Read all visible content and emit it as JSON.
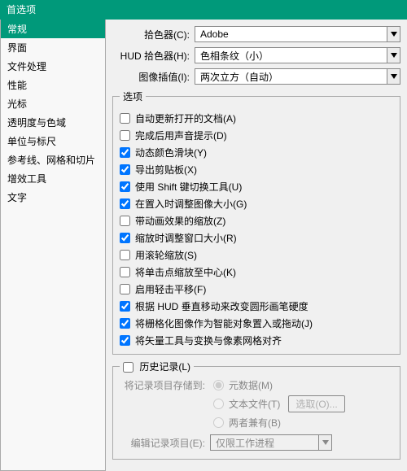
{
  "window": {
    "title": "首选项"
  },
  "sidebar": {
    "items": [
      {
        "label": "常规",
        "selected": true
      },
      {
        "label": "界面"
      },
      {
        "label": "文件处理"
      },
      {
        "label": "性能"
      },
      {
        "label": "光标"
      },
      {
        "label": "透明度与色域"
      },
      {
        "label": "单位与标尺"
      },
      {
        "label": "参考线、网格和切片"
      },
      {
        "label": "增效工具"
      },
      {
        "label": "文字"
      }
    ]
  },
  "top": {
    "picker_label": "拾色器(C):",
    "picker_value": "Adobe",
    "hud_label": "HUD 拾色器(H):",
    "hud_value": "色相条纹（小）",
    "interp_label": "图像插值(I):",
    "interp_value": "两次立方（自动）"
  },
  "options": {
    "legend": "选项",
    "items": [
      {
        "label": "自动更新打开的文档(A)",
        "checked": false
      },
      {
        "label": "完成后用声音提示(D)",
        "checked": false
      },
      {
        "label": "动态颜色滑块(Y)",
        "checked": true
      },
      {
        "label": "导出剪贴板(X)",
        "checked": true
      },
      {
        "label": "使用 Shift 键切换工具(U)",
        "checked": true
      },
      {
        "label": "在置入时调整图像大小(G)",
        "checked": true
      },
      {
        "label": "带动画效果的缩放(Z)",
        "checked": false
      },
      {
        "label": "缩放时调整窗口大小(R)",
        "checked": true
      },
      {
        "label": "用滚轮缩放(S)",
        "checked": false
      },
      {
        "label": "将单击点缩放至中心(K)",
        "checked": false
      },
      {
        "label": "启用轻击平移(F)",
        "checked": false
      },
      {
        "label": "根据 HUD 垂直移动来改变圆形画笔硬度",
        "checked": true
      },
      {
        "label": "将栅格化图像作为智能对象置入或拖动(J)",
        "checked": true
      },
      {
        "label": "将矢量工具与变换与像素网格对齐",
        "checked": true
      }
    ]
  },
  "history": {
    "legend": "历史记录(L)",
    "enabled": false,
    "save_label": "将记录项目存储到:",
    "radios": [
      {
        "label": "元数据(M)"
      },
      {
        "label": "文本文件(T)"
      },
      {
        "label": "两者兼有(B)"
      }
    ],
    "choose_btn": "选取(O)...",
    "edit_label": "编辑记录项目(E):",
    "edit_value": "仅限工作进程"
  }
}
